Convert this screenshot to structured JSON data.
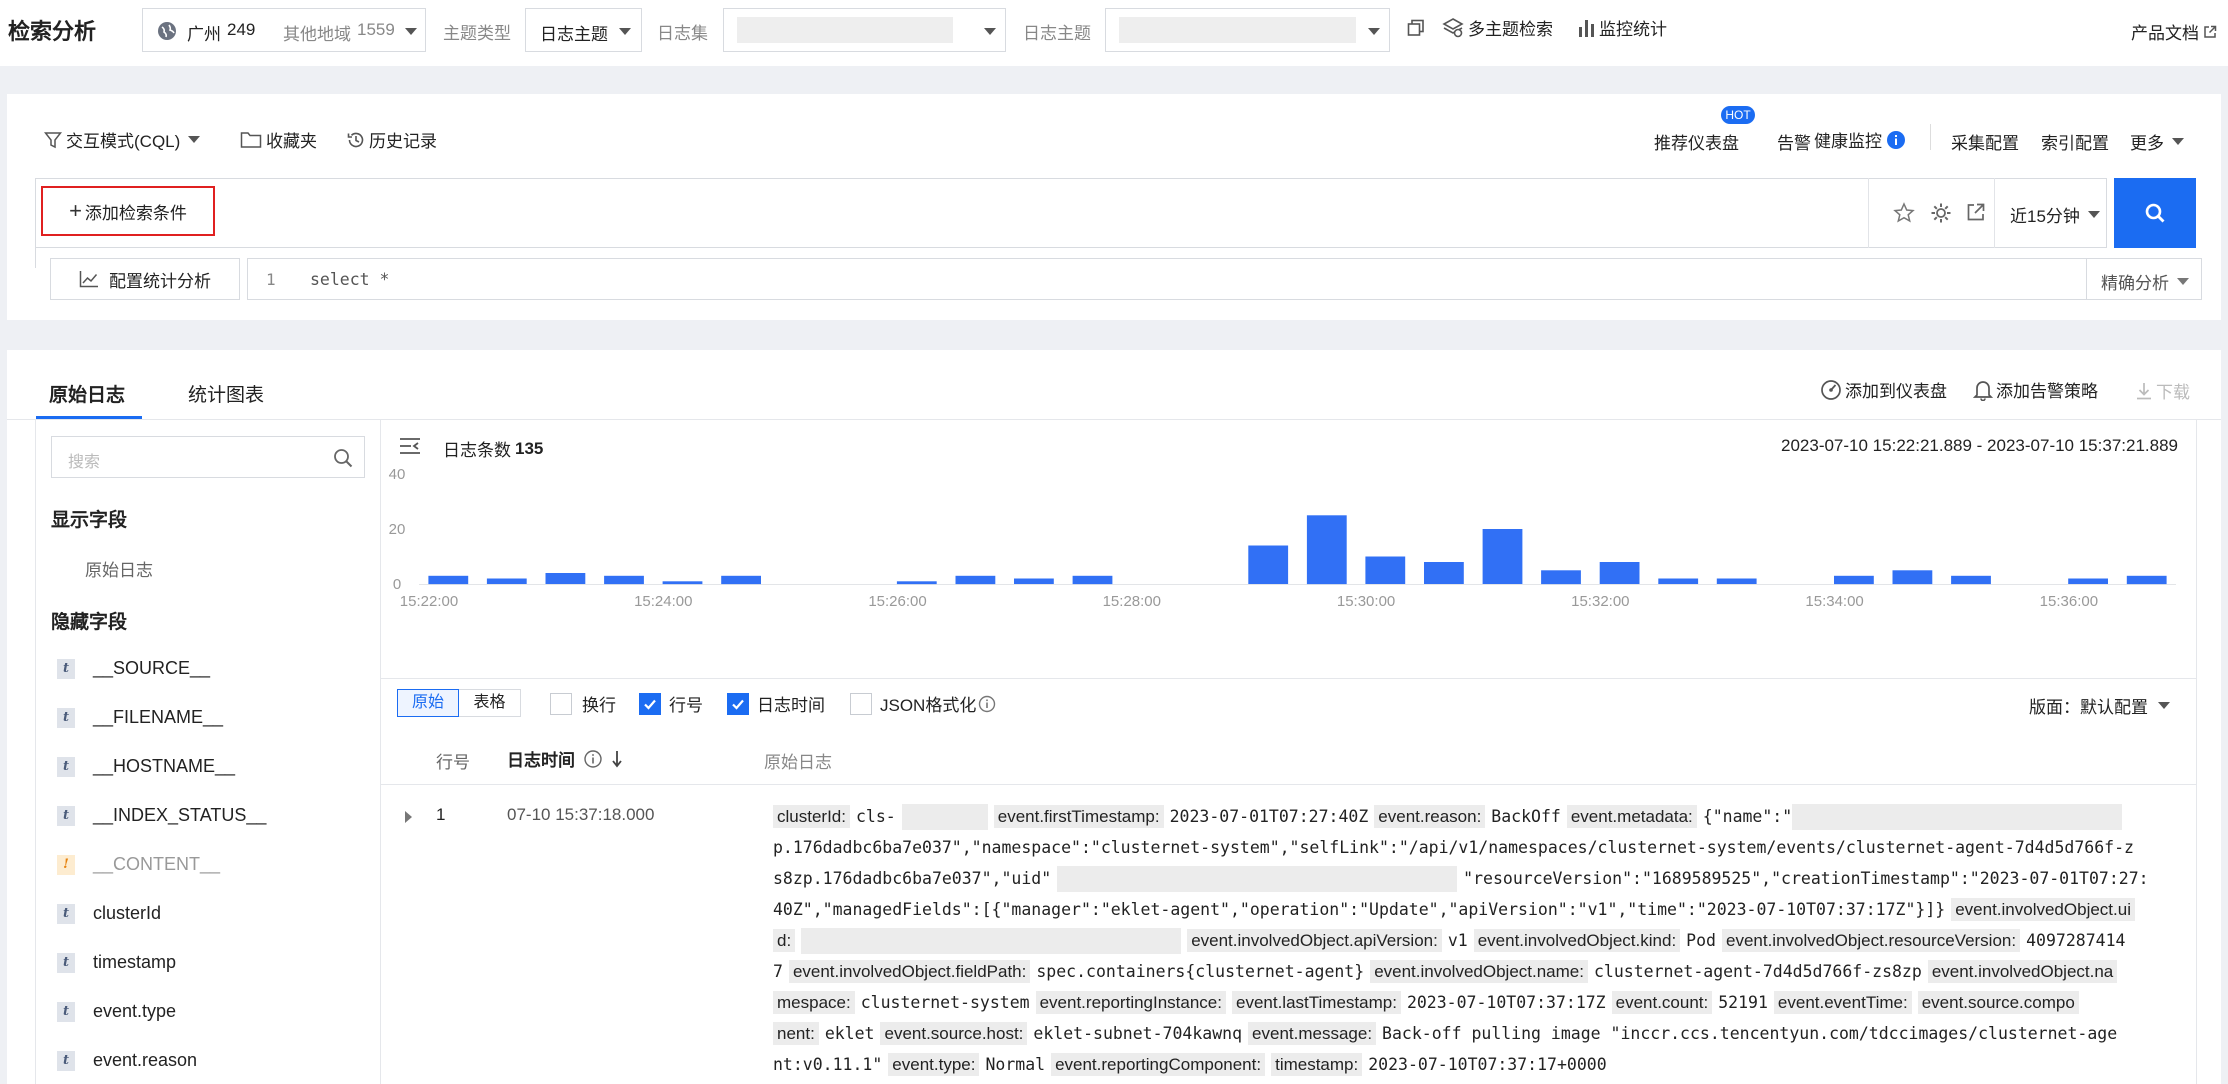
{
  "topbar": {
    "title": "检索分析",
    "region_label": "广州",
    "region_count": "249",
    "other_region_label": "其他地域",
    "other_region_count": "1559",
    "topic_type_label": "主题类型",
    "topic_type_value": "日志主题",
    "logset_label": "日志集",
    "log_topic_label": "日志主题",
    "multi_topic_search": "多主题检索",
    "monitor_stats": "监控统计",
    "product_docs": "产品文档"
  },
  "query_panel": {
    "mode": "交互模式(CQL)",
    "favorites": "收藏夹",
    "history": "历史记录",
    "recommended_dashboard": "推荐仪表盘",
    "hot_badge": "HOT",
    "alarm": "告警",
    "health_monitor": "健康监控",
    "collect_config": "采集配置",
    "index_config": "索引配置",
    "more": "更多",
    "add_condition": "添加检索条件",
    "time_range": "近15分钟",
    "config_stats": "配置统计分析",
    "sql_line_no": "1",
    "sql_text": "select *",
    "precise_analysis": "精确分析"
  },
  "tabs": {
    "raw_log": "原始日志",
    "stats_chart": "统计图表",
    "add_to_dashboard": "添加到仪表盘",
    "add_alarm_policy": "添加告警策略",
    "download": "下载"
  },
  "sidebar": {
    "search_placeholder": "搜索",
    "display_fields_title": "显示字段",
    "display_fields": [
      "原始日志"
    ],
    "hidden_fields_title": "隐藏字段",
    "hidden_fields": [
      {
        "name": "__SOURCE__",
        "type": "t"
      },
      {
        "name": "__FILENAME__",
        "type": "t"
      },
      {
        "name": "__HOSTNAME__",
        "type": "t"
      },
      {
        "name": "__INDEX_STATUS__",
        "type": "t"
      },
      {
        "name": "__CONTENT__",
        "type": "!"
      },
      {
        "name": "clusterId",
        "type": "t"
      },
      {
        "name": "timestamp",
        "type": "t"
      },
      {
        "name": "event.type",
        "type": "t"
      },
      {
        "name": "event.reason",
        "type": "t"
      }
    ]
  },
  "histogram": {
    "count_label": "日志条数",
    "count_value": "135",
    "range_text": "2023-07-10 15:22:21.889 - 2023-07-10 15:37:21.889"
  },
  "chart_data": {
    "type": "bar",
    "x": [
      "15:22:30",
      "15:23:00",
      "15:23:30",
      "15:24:00",
      "15:24:30",
      "15:25:00",
      "15:25:30",
      "15:26:00",
      "15:26:30",
      "15:27:00",
      "15:27:30",
      "15:28:00",
      "15:28:30",
      "15:29:00",
      "15:29:30",
      "15:30:00",
      "15:30:30",
      "15:31:00",
      "15:31:30",
      "15:32:00",
      "15:32:30",
      "15:33:00",
      "15:33:30",
      "15:34:00",
      "15:34:30",
      "15:35:00",
      "15:35:30",
      "15:36:00",
      "15:36:30",
      "15:37:00"
    ],
    "values": [
      3,
      2,
      4,
      3,
      1,
      3,
      0,
      0,
      1,
      3,
      2,
      3,
      0,
      0,
      14,
      25,
      10,
      8,
      20,
      5,
      8,
      2,
      2,
      0,
      3,
      5,
      3,
      0,
      2,
      3
    ],
    "x_ticks": [
      "15:22:00",
      "15:24:00",
      "15:26:00",
      "15:28:00",
      "15:30:00",
      "15:32:00",
      "15:34:00",
      "15:36:00"
    ],
    "y_ticks": [
      "0",
      "20",
      "40"
    ],
    "ylim": [
      0,
      40
    ],
    "grid": false,
    "color": "#3170f5"
  },
  "toolbar": {
    "view_raw": "原始",
    "view_table": "表格",
    "wrap": "换行",
    "line_no": "行号",
    "log_time": "日志时间",
    "json_format": "JSON格式化",
    "layout_label": "版面：",
    "layout_value": "默认配置"
  },
  "table": {
    "col_line": "行号",
    "col_time": "日志时间",
    "col_raw": "原始日志",
    "rows": [
      {
        "line": "1",
        "time": "07-10 15:37:18.000",
        "l1": {
          "k1": "clusterId:",
          "v1": "cls-",
          "k2": "event.firstTimestamp:",
          "v2": "2023-07-01T07:27:40Z",
          "k3": "event.reason:",
          "v3": "BackOff",
          "k4": "event.metadata:",
          "v4": "{\"name\":\""
        },
        "l2": "p.176dadbc6ba7e037\",\"namespace\":\"clusternet-system\",\"selfLink\":\"/api/v1/namespaces/clusternet-system/events/clusternet-agent-7d4d5d766f-z",
        "l3": "s8zp.176dadbc6ba7e037\",\"uid\"",
        "l3b": "\"resourceVersion\":\"1689589525\",\"creationTimestamp\":\"2023-07-01T07:27:",
        "l4": "40Z\",\"managedFields\":[{\"manager\":\"eklet-agent\",\"operation\":\"Update\",\"apiVersion\":\"v1\",\"time\":\"2023-07-10T07:37:17Z\"}]}",
        "l4k": "event.involvedObject.ui",
        "l5k": "d:",
        "l5": {
          "k1": "event.involvedObject.apiVersion:",
          "v1": "v1",
          "k2": "event.involvedObject.kind:",
          "v2": "Pod",
          "k3": "event.involvedObject.resourceVersion:",
          "v3": "409728741​4"
        },
        "l6": {
          "v0": "7",
          "k1": "event.involvedObject.fieldPath:",
          "v1": "spec.containers{clusternet-agent}",
          "k2": "event.involvedObject.name:",
          "v2": "clusternet-agent-7d4d5d766f-zs8zp",
          "k3": "event.involvedObject.na"
        },
        "l7": {
          "k0": "mespace:",
          "v0": "clusternet-system",
          "k1": "event.reportingInstance:",
          "k2": "event.lastTimestamp:",
          "v2": "2023-07-10T07:37:17Z",
          "k3": "event.count:",
          "v3": "52191",
          "k4": "event.eventTime:",
          "k5": "event.source.compo"
        },
        "l8": {
          "k0": "nent:",
          "v0": "eklet",
          "k1": "event.source.host:",
          "v1": "eklet-subnet-704kawnq",
          "k2": "event.message:",
          "v2": "Back-off pulling image \"inccr.ccs.tencentyun.com/tdccimages/clusternet-age"
        },
        "l9": {
          "v0": "nt:v0.11.1\"",
          "k1": "event.type:",
          "v1": "Normal",
          "k2": "event.reportingComponent:",
          "k3": "timestamp:",
          "v3": "2023-07-10T07:37:17+0000"
        }
      }
    ]
  }
}
